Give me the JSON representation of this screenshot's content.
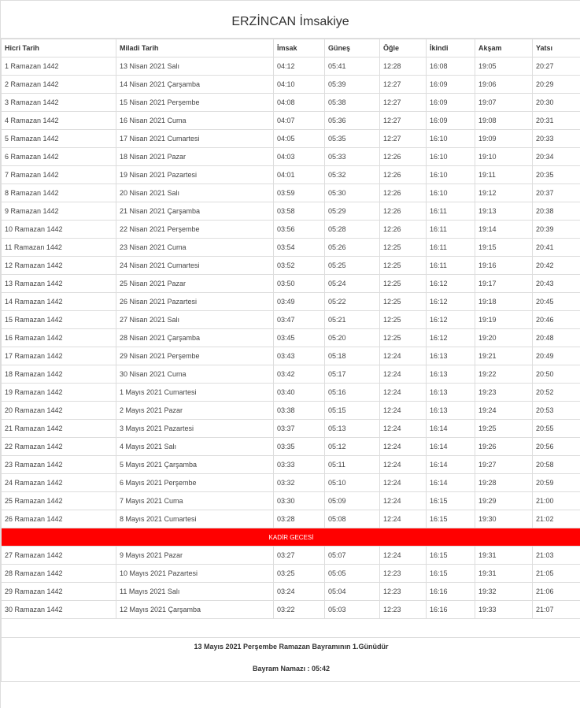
{
  "page": {
    "title": "ERZİNCAN İmsakiye"
  },
  "table": {
    "headers": [
      "Hicri Tarih",
      "Miladi Tarih",
      "İmsak",
      "Güneş",
      "Öğle",
      "İkindi",
      "Akşam",
      "Yatsı"
    ],
    "rows": [
      [
        "1 Ramazan 1442",
        "13 Nisan 2021 Salı",
        "04:12",
        "05:41",
        "12:28",
        "16:08",
        "19:05",
        "20:27"
      ],
      [
        "2 Ramazan 1442",
        "14 Nisan 2021 Çarşamba",
        "04:10",
        "05:39",
        "12:27",
        "16:09",
        "19:06",
        "20:29"
      ],
      [
        "3 Ramazan 1442",
        "15 Nisan 2021 Perşembe",
        "04:08",
        "05:38",
        "12:27",
        "16:09",
        "19:07",
        "20:30"
      ],
      [
        "4 Ramazan 1442",
        "16 Nisan 2021 Cuma",
        "04:07",
        "05:36",
        "12:27",
        "16:09",
        "19:08",
        "20:31"
      ],
      [
        "5 Ramazan 1442",
        "17 Nisan 2021 Cumartesi",
        "04:05",
        "05:35",
        "12:27",
        "16:10",
        "19:09",
        "20:33"
      ],
      [
        "6 Ramazan 1442",
        "18 Nisan 2021 Pazar",
        "04:03",
        "05:33",
        "12:26",
        "16:10",
        "19:10",
        "20:34"
      ],
      [
        "7 Ramazan 1442",
        "19 Nisan 2021 Pazartesi",
        "04:01",
        "05:32",
        "12:26",
        "16:10",
        "19:11",
        "20:35"
      ],
      [
        "8 Ramazan 1442",
        "20 Nisan 2021 Salı",
        "03:59",
        "05:30",
        "12:26",
        "16:10",
        "19:12",
        "20:37"
      ],
      [
        "9 Ramazan 1442",
        "21 Nisan 2021 Çarşamba",
        "03:58",
        "05:29",
        "12:26",
        "16:11",
        "19:13",
        "20:38"
      ],
      [
        "10 Ramazan 1442",
        "22 Nisan 2021 Perşembe",
        "03:56",
        "05:28",
        "12:26",
        "16:11",
        "19:14",
        "20:39"
      ],
      [
        "11 Ramazan 1442",
        "23 Nisan 2021 Cuma",
        "03:54",
        "05:26",
        "12:25",
        "16:11",
        "19:15",
        "20:41"
      ],
      [
        "12 Ramazan 1442",
        "24 Nisan 2021 Cumartesi",
        "03:52",
        "05:25",
        "12:25",
        "16:11",
        "19:16",
        "20:42"
      ],
      [
        "13 Ramazan 1442",
        "25 Nisan 2021 Pazar",
        "03:50",
        "05:24",
        "12:25",
        "16:12",
        "19:17",
        "20:43"
      ],
      [
        "14 Ramazan 1442",
        "26 Nisan 2021 Pazartesi",
        "03:49",
        "05:22",
        "12:25",
        "16:12",
        "19:18",
        "20:45"
      ],
      [
        "15 Ramazan 1442",
        "27 Nisan 2021 Salı",
        "03:47",
        "05:21",
        "12:25",
        "16:12",
        "19:19",
        "20:46"
      ],
      [
        "16 Ramazan 1442",
        "28 Nisan 2021 Çarşamba",
        "03:45",
        "05:20",
        "12:25",
        "16:12",
        "19:20",
        "20:48"
      ],
      [
        "17 Ramazan 1442",
        "29 Nisan 2021 Perşembe",
        "03:43",
        "05:18",
        "12:24",
        "16:13",
        "19:21",
        "20:49"
      ],
      [
        "18 Ramazan 1442",
        "30 Nisan 2021 Cuma",
        "03:42",
        "05:17",
        "12:24",
        "16:13",
        "19:22",
        "20:50"
      ],
      [
        "19 Ramazan 1442",
        "1 Mayıs 2021 Cumartesi",
        "03:40",
        "05:16",
        "12:24",
        "16:13",
        "19:23",
        "20:52"
      ],
      [
        "20 Ramazan 1442",
        "2 Mayıs 2021 Pazar",
        "03:38",
        "05:15",
        "12:24",
        "16:13",
        "19:24",
        "20:53"
      ],
      [
        "21 Ramazan 1442",
        "3 Mayıs 2021 Pazartesi",
        "03:37",
        "05:13",
        "12:24",
        "16:14",
        "19:25",
        "20:55"
      ],
      [
        "22 Ramazan 1442",
        "4 Mayıs 2021 Salı",
        "03:35",
        "05:12",
        "12:24",
        "16:14",
        "19:26",
        "20:56"
      ],
      [
        "23 Ramazan 1442",
        "5 Mayıs 2021 Çarşamba",
        "03:33",
        "05:11",
        "12:24",
        "16:14",
        "19:27",
        "20:58"
      ],
      [
        "24 Ramazan 1442",
        "6 Mayıs 2021 Perşembe",
        "03:32",
        "05:10",
        "12:24",
        "16:14",
        "19:28",
        "20:59"
      ],
      [
        "25 Ramazan 1442",
        "7 Mayıs 2021 Cuma",
        "03:30",
        "05:09",
        "12:24",
        "16:15",
        "19:29",
        "21:00"
      ],
      [
        "26 Ramazan 1442",
        "8 Mayıs 2021 Cumartesi",
        "03:28",
        "05:08",
        "12:24",
        "16:15",
        "19:30",
        "21:02"
      ]
    ],
    "kadir_label": "KADİR GECESİ",
    "rows_after": [
      [
        "27 Ramazan 1442",
        "9 Mayıs 2021 Pazar",
        "03:27",
        "05:07",
        "12:24",
        "16:15",
        "19:31",
        "21:03"
      ],
      [
        "28 Ramazan 1442",
        "10 Mayıs 2021 Pazartesi",
        "03:25",
        "05:05",
        "12:23",
        "16:15",
        "19:31",
        "21:05"
      ],
      [
        "29 Ramazan 1442",
        "11 Mayıs 2021 Salı",
        "03:24",
        "05:04",
        "12:23",
        "16:16",
        "19:32",
        "21:06"
      ],
      [
        "30 Ramazan 1442",
        "12 Mayıs 2021 Çarşamba",
        "03:22",
        "05:03",
        "12:23",
        "16:16",
        "19:33",
        "21:07"
      ]
    ]
  },
  "footer": {
    "bayram_note": "13 Mayıs 2021 Perşembe Ramazan Bayramının 1.Günüdür",
    "bayram_namazi": "Bayram Namazı : 05:42"
  },
  "colors": {
    "kadir_highlight": "#ff0000",
    "border": "#dddddd"
  }
}
